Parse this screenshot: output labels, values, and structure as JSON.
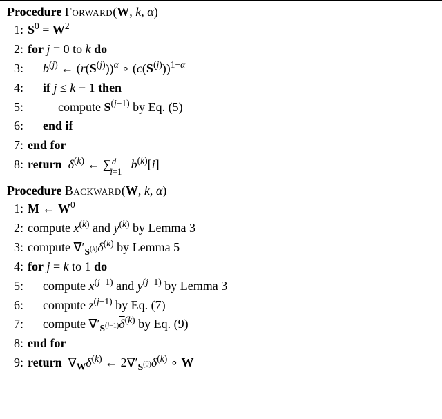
{
  "forward": {
    "header_kw": "Procedure",
    "name_sc": "Forward",
    "args": "(W, k, α)",
    "lines": {
      "l1": {
        "num": "1:",
        "body": "<b>S</b><sup>0</sup> = <b>W</b><sup>2</sup>"
      },
      "l2": {
        "num": "2:",
        "body": "<span class=\"kw\">for</span> <span class=\"italic\">j</span> = 0 to <span class=\"italic\">k</span> <span class=\"kw\">do</span>"
      },
      "l3": {
        "num": "3:",
        "body": "<span class=\"italic\">b</span><sup>(<span class=\"italic\">j</span>)</sup> ← (<span class=\"italic\">r</span>(<b>S</b><sup>(<span class=\"italic\">j</span>)</sup>))<sup><span class=\"italic\">α</span></sup> ∘ (<span class=\"italic\">c</span>(<b>S</b><sup>(<span class=\"italic\">j</span>)</sup>))<sup>1−<span class=\"italic\">α</span></sup>"
      },
      "l4": {
        "num": "4:",
        "body": "<span class=\"kw\">if</span> <span class=\"italic\">j</span> ≤ <span class=\"italic\">k</span> − 1 <span class=\"kw\">then</span>"
      },
      "l5": {
        "num": "5:",
        "body": "compute <b>S</b><sup>(<span class=\"italic\">j</span>+1)</sup> by Eq. (5)"
      },
      "l6": {
        "num": "6:",
        "body": "<span class=\"kw\">end if</span>"
      },
      "l7": {
        "num": "7:",
        "body": "<span class=\"kw\">end for</span>"
      },
      "l8": {
        "num": "8:",
        "body": "<span class=\"kw\">return</span>&nbsp;&nbsp;<span style=\"text-decoration:overline;\"><span class=\"italic\">δ</span></span><sup>(<span class=\"italic\">k</span>)</sup> ← ∑<span style=\"position:relative;top:-0.5em;font-size:0.7em;\"><span class=\"italic\">d</span></span><sub style=\"position:relative;left:-0.7em;top:0.3em;font-size:0.7em;\"><span class=\"italic\">i</span>=1</sub>&nbsp;<span class=\"italic\">b</span><sup>(<span class=\"italic\">k</span>)</sup>[<span class=\"italic\">i</span>]"
      }
    }
  },
  "backward": {
    "header_kw": "Procedure",
    "name_sc": "Backward",
    "args": "(W, k, α)",
    "lines": {
      "l1": {
        "num": "1:",
        "body": "<b>M</b> ← <b>W</b><sup>0</sup>"
      },
      "l2": {
        "num": "2:",
        "body": "compute <span class=\"italic\">x</span><sup>(<span class=\"italic\">k</span>)</sup> and <span class=\"italic\">y</span><sup>(<span class=\"italic\">k</span>)</sup> by Lemma 3"
      },
      "l3": {
        "num": "3:",
        "body": "compute ∇′<sub><b>S</b><sup>(<span class=\"italic\">k</span>)</sup></sub><span style=\"text-decoration:overline;\"><span class=\"italic\">δ</span></span><sup>(<span class=\"italic\">k</span>)</sup> by Lemma 5"
      },
      "l4": {
        "num": "4:",
        "body": "<span class=\"kw\">for</span> <span class=\"italic\">j</span> = <span class=\"italic\">k</span> to 1 <span class=\"kw\">do</span>"
      },
      "l5": {
        "num": "5:",
        "body": "compute <span class=\"italic\">x</span><sup>(<span class=\"italic\">j</span>−1)</sup> and <span class=\"italic\">y</span><sup>(<span class=\"italic\">j</span>−1)</sup> by Lemma 3"
      },
      "l6": {
        "num": "6:",
        "body": "compute <span class=\"italic\">z</span><sup>(<span class=\"italic\">j</span>−1)</sup> by Eq. (7)"
      },
      "l7": {
        "num": "7:",
        "body": "compute ∇′<sub><b>S</b><sup>(<span class=\"italic\">j</span>−1)</sup></sub><span style=\"text-decoration:overline;\"><span class=\"italic\">δ</span></span><sup>(<span class=\"italic\">k</span>)</sup> by Eq. (9)"
      },
      "l8": {
        "num": "8:",
        "body": "<span class=\"kw\">end for</span>"
      },
      "l9": {
        "num": "9:",
        "body": "<span class=\"kw\">return</span>&nbsp;&nbsp;∇<sub><b>W</b></sub><span style=\"text-decoration:overline;\"><span class=\"italic\">δ</span></span><sup>(<span class=\"italic\">k</span>)</sup> ← 2∇′<sub><b>S</b><sup>(0)</sup></sub><span style=\"text-decoration:overline;\"><span class=\"italic\">δ</span></span><sup>(<span class=\"italic\">k</span>)</sup> ∘ <b>W</b>"
      }
    }
  }
}
